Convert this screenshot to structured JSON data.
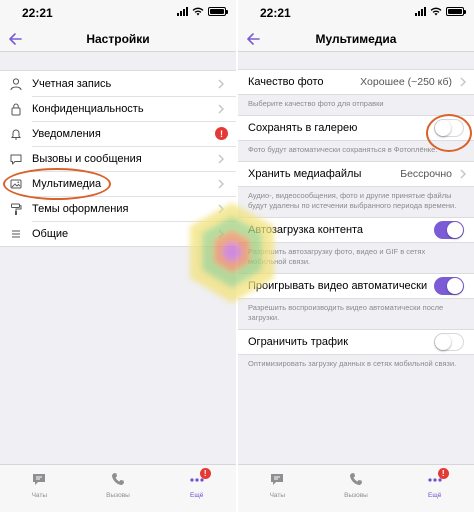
{
  "accent_color": "#7b5cd6",
  "highlight_color": "#d9622b",
  "left": {
    "status": {
      "time": "22:21"
    },
    "nav": {
      "title": "Настройки"
    },
    "items": [
      {
        "label": "Учетная запись",
        "icon": "person-icon"
      },
      {
        "label": "Конфиденциальность",
        "icon": "lock-icon"
      },
      {
        "label": "Уведомления",
        "icon": "bell-icon",
        "badge": "!"
      },
      {
        "label": "Вызовы и сообщения",
        "icon": "chat-bubble-icon"
      },
      {
        "label": "Мультимедиа",
        "icon": "image-icon"
      },
      {
        "label": "Темы оформления",
        "icon": "paint-roller-icon"
      },
      {
        "label": "Общие",
        "icon": "list-icon"
      }
    ],
    "tabbar": [
      {
        "label": "Чаты",
        "icon": "chats-icon"
      },
      {
        "label": "Вызовы",
        "icon": "phone-icon"
      },
      {
        "label": "Ещё",
        "icon": "more-icon",
        "badge": "!"
      }
    ]
  },
  "right": {
    "status": {
      "time": "22:21"
    },
    "nav": {
      "title": "Мультимедиа"
    },
    "photo_quality": {
      "label": "Качество фото",
      "value": "Хорошее (~250 кб)",
      "note": "Выберите качество фото для отправки"
    },
    "save_to_gallery": {
      "label": "Сохранять в галерею",
      "enabled": false,
      "note": "Фото будут автоматически сохраняться в Фотоплёнке."
    },
    "keep_media": {
      "label": "Хранить медиафайлы",
      "value": "Бессрочно",
      "note": "Аудио-, видеосообщения, фото и другие принятые файлы будут удалены по истечении выбранного периода времени."
    },
    "autoload": {
      "label": "Автозагрузка контента",
      "enabled": true,
      "note": "Разрешить автозагрузку фото, видео и GIF в сетях мобильной связи."
    },
    "autoplay": {
      "label": "Проигрывать видео автоматически",
      "enabled": true,
      "note": "Разрешить воспроизводить видео автоматически после загрузки."
    },
    "limit_traffic": {
      "label": "Ограничить трафик",
      "enabled": false,
      "note": "Оптимизировать загрузку данных в сетях мобильной связи."
    },
    "tabbar": [
      {
        "label": "Чаты",
        "icon": "chats-icon"
      },
      {
        "label": "Вызовы",
        "icon": "phone-icon"
      },
      {
        "label": "Ещё",
        "icon": "more-icon",
        "badge": "!"
      }
    ]
  }
}
